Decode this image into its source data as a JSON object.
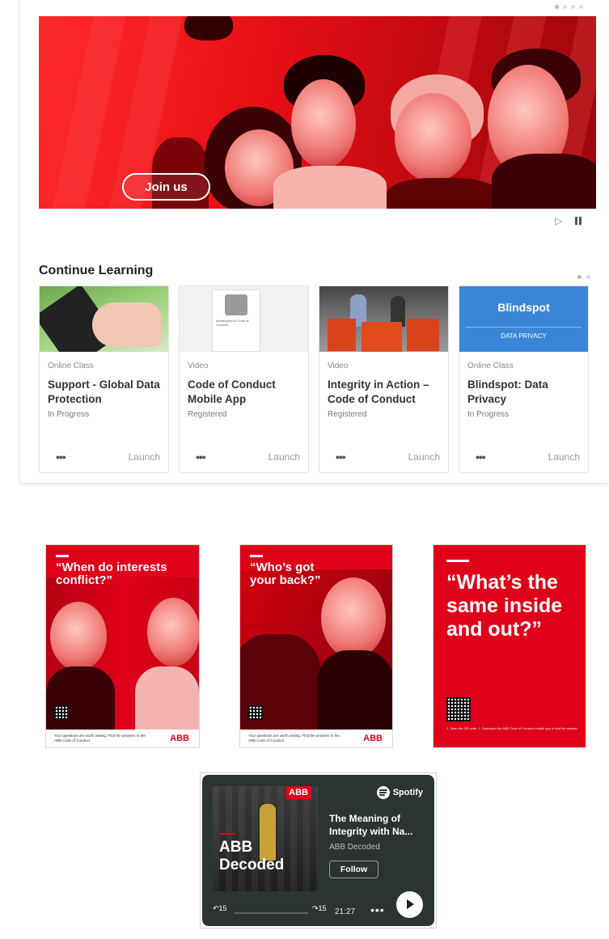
{
  "hero": {
    "join_label": "Join us"
  },
  "section": {
    "title": "Continue Learning"
  },
  "cards": [
    {
      "type": "Online Class",
      "title": "Support - Global Data Protection",
      "status": "In Progress",
      "more": "•••",
      "launch": "Launch"
    },
    {
      "type": "Video",
      "title": "Code of Conduct Mobile App",
      "status": "Registered",
      "more": "•••",
      "launch": "Launch",
      "thumb_title": "Introduction to Code of Conduct"
    },
    {
      "type": "Video",
      "title": "Integrity in Action – Code of Conduct",
      "status": "Registered",
      "more": "•••",
      "launch": "Launch"
    },
    {
      "type": "Online Class",
      "title": "Blindspot: Data Privacy",
      "status": "In Progress",
      "more": "•••",
      "launch": "Launch",
      "thumb_brand": "Blindspot",
      "thumb_tag": "DATA PRIVACY"
    }
  ],
  "posters": [
    {
      "title": "“When do interests conflict?”",
      "foot": "Your questions are worth asking. Find the answers in the ABB Code of Conduct.",
      "brand": "ABB"
    },
    {
      "title": "“Who’s got your back?”",
      "foot": "Your questions are worth asking. Find the answers in the ABB Code of Conduct.",
      "brand": "ABB"
    },
    {
      "title": "“What’s the same inside and out?”",
      "qr_text": "1. Scan the QR code. 2. Download the ABB Code of Conduct mobile app to find the answer."
    }
  ],
  "spotify": {
    "brand": "Spotify",
    "episode_title": "The Meaning of Integrity with Na...",
    "show": "ABB Decoded",
    "follow": "Follow",
    "cover_text": "ABB Decoded",
    "cover_brand": "ABB",
    "skip_back": "15",
    "skip_fwd": "15",
    "time": "21:27",
    "more": "•••"
  },
  "colors": {
    "abb_red": "#e0001a",
    "spotify_bg": "#2b3431",
    "blindspot_blue": "#3a86d6"
  },
  "icons": [
    "play-icon",
    "pause-icon",
    "more-icon",
    "spotify-icon",
    "qr-code-icon"
  ]
}
